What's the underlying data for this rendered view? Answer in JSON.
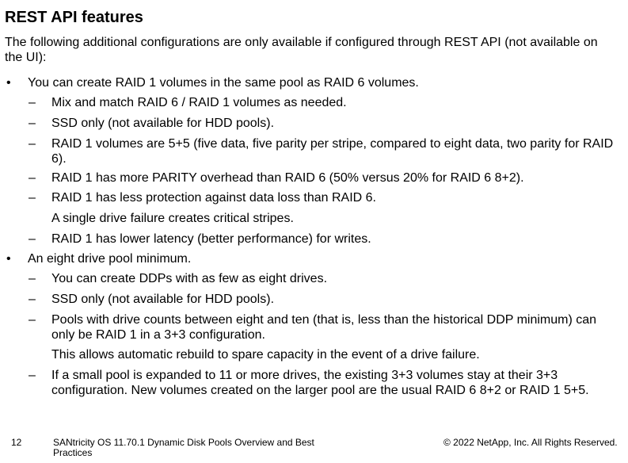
{
  "heading": "REST API features",
  "intro": "The following additional configurations are only available if configured through REST API (not available on the UI):",
  "bullet_symbol": "•",
  "dash_symbol": "–",
  "items": [
    {
      "text": "You can create RAID 1 volumes in the same pool as RAID 6 volumes.",
      "subitems": [
        "Mix and match RAID 6 / RAID 1 volumes as needed.",
        "SSD only (not available for HDD pools).",
        "RAID 1 volumes are 5+5 (five data, five parity per stripe, compared to eight data, two parity for RAID 6).",
        "RAID 1 has more PARITY overhead than RAID 6 (50% versus 20% for RAID 6 8+2).",
        "RAID 1 has less protection against data loss than RAID 6.",
        "RAID 1 has lower latency (better performance) for writes."
      ],
      "note": "A single drive failure creates critical stripes."
    },
    {
      "text": "An eight drive pool minimum.",
      "subitems": [
        "You can create DDPs with as few as eight drives.",
        "SSD only (not available for HDD pools).",
        "Pools with drive counts between eight and ten (that is, less than the historical DDP minimum) can only be RAID 1 in a 3+3 configuration.",
        "If a small pool is expanded to 11 or more drives, the existing 3+3 volumes stay at their 3+3 configuration. New volumes created on the larger pool are the usual RAID 6 8+2 or RAID 1 5+5."
      ],
      "note": "This allows automatic rebuild to spare capacity in the event of a drive failure."
    }
  ],
  "footer": {
    "page_number": "12",
    "doc_title": "SANtricity OS 11.70.1 Dynamic Disk Pools Overview and Best Practices",
    "copyright": "© 2022 NetApp, Inc. All Rights Reserved."
  }
}
